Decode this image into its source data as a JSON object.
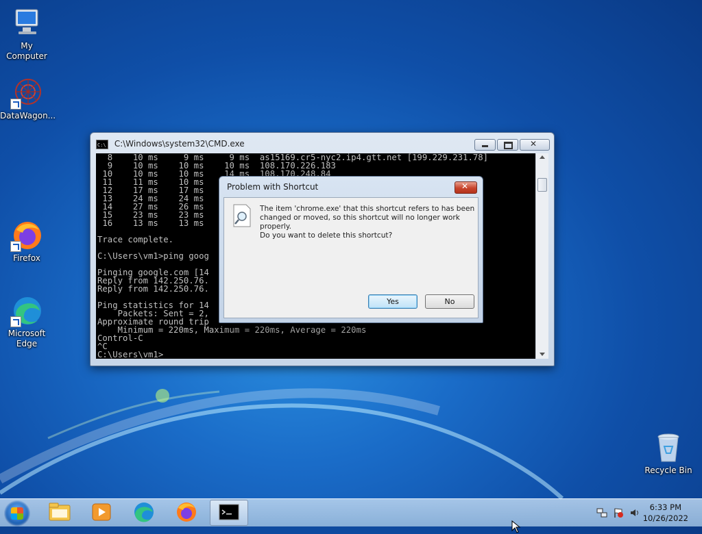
{
  "desktop": {
    "icons": [
      {
        "label": "My Computer",
        "icon": "computer-icon"
      },
      {
        "label": "DataWagon...",
        "icon": "datawagon-icon"
      },
      {
        "label": "Firefox",
        "icon": "firefox-icon"
      },
      {
        "label": "Microsoft Edge",
        "icon": "edge-icon"
      },
      {
        "label": "Recycle Bin",
        "icon": "recycle-bin-icon"
      }
    ]
  },
  "cmd_window": {
    "title": "C:\\Windows\\system32\\CMD.exe",
    "lines": [
      "  8    10 ms     9 ms     9 ms  as15169.cr5-nyc2.ip4.gtt.net [199.229.231.78]",
      "  9    10 ms    10 ms    10 ms  108.170.226.183",
      " 10    10 ms    10 ms    14 ms  108.170.248.84",
      " 11    11 ms    10 ms",
      " 12    17 ms    17 ms",
      " 13    24 ms    24 ms",
      " 14    27 ms    26 ms",
      " 15    23 ms    23 ms",
      " 16    13 ms    13 ms                                                    46]",
      "",
      "Trace complete.",
      "",
      "C:\\Users\\vm1>ping goog",
      "",
      "Pinging google.com [14",
      "Reply from 142.250.76.",
      "Reply from 142.250.76.",
      "",
      "Ping statistics for 14",
      "    Packets: Sent = 2,",
      "Approximate round trip",
      "    Minimum = 220ms, Maximum = 220ms, Average = 220ms",
      "Control-C",
      "^C",
      "C:\\Users\\vm1>"
    ]
  },
  "dialog": {
    "title": "Problem with Shortcut",
    "message": "The item 'chrome.exe' that this shortcut refers to has been changed or moved, so this shortcut will no longer work properly.",
    "question": "Do you want to delete this shortcut?",
    "yes_label": "Yes",
    "no_label": "No"
  },
  "taskbar": {
    "items": [
      "windows-explorer-icon",
      "media-player-icon",
      "edge-icon",
      "firefox-icon",
      "cmd-icon"
    ],
    "time": "6:33 PM",
    "date": "10/26/2022"
  }
}
